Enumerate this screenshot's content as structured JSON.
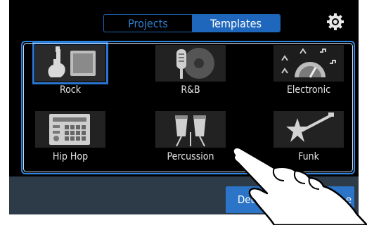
{
  "tabs": {
    "projects": "Projects",
    "templates": "Templates"
  },
  "templates": [
    {
      "label": "Rock",
      "icon": "guitar-amp-icon"
    },
    {
      "label": "R&B",
      "icon": "microphone-record-icon"
    },
    {
      "label": "Electronic",
      "icon": "synth-knob-icon"
    },
    {
      "label": "Hip Hop",
      "icon": "drum-machine-icon"
    },
    {
      "label": "Percussion",
      "icon": "conga-drums-icon"
    },
    {
      "label": "Funk",
      "icon": "star-guitar-icon"
    }
  ],
  "actions": {
    "details": "Deta",
    "save": "e"
  },
  "colors": {
    "accent": "#1f67bd",
    "frame": "#2e85e0",
    "bar": "#2d3a47"
  }
}
